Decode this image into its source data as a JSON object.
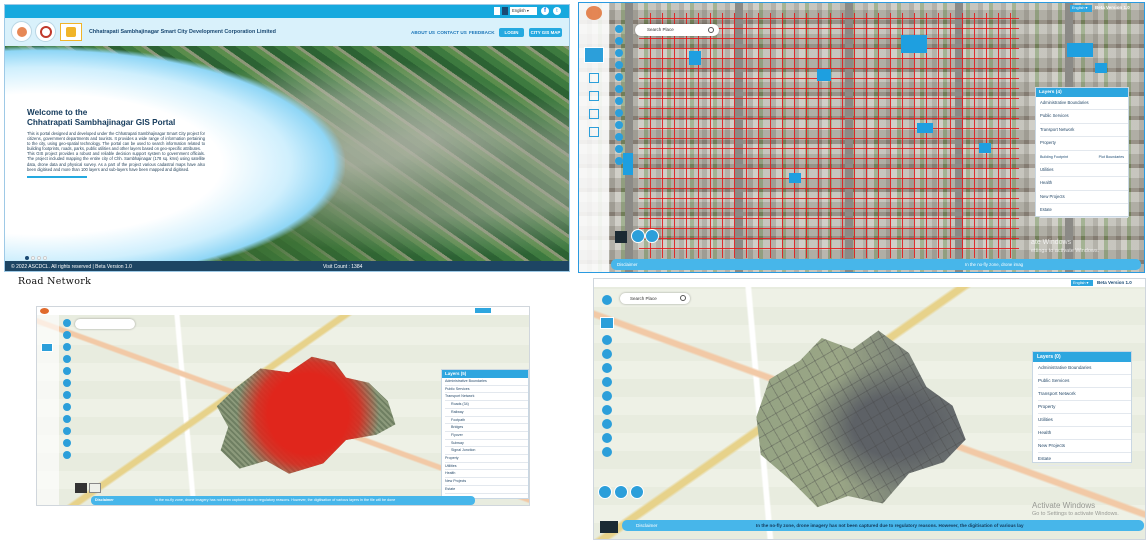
{
  "panel1": {
    "lang_select": "English",
    "org_name": "Chhatrapati Sambhajinagar Smart City Development Corporation Limited",
    "nav": [
      "ABOUT US",
      "CONTACT US",
      "FEEDBACK"
    ],
    "login_button": "LOGIN",
    "city_map_button": "CITY GIS MAP",
    "welcome_line1": "Welcome to the",
    "welcome_line2": "Chhatrapati Sambhajinagar GIS Portal",
    "para1": "This is portal designed and developed under the Chhatrapati Sambhajinagar Smart City project for citizens, government departments and tourists. It provides a wide range of information pertaining to the city, using geo-spatial technology. The portal can be used to search information related to building footprints, roads, parks, public utilities and other layers based on geo-specific attributes.",
    "para2": "This GIS project provides a robust and reliable decision support system to government officials. The project included mapping the entire city of Chh. Sambhajinagar (178 sq. kms) using satellite data, drone data and physical survey. As a part of the project various cadastral maps have also been digitised and more than 100 layers and sub-layers have been mapped and digitised.",
    "copyright": "© 2022 ASCDCL. All rights reserved | Beta Version 1.0",
    "visit_count": "Visit Count : 1384"
  },
  "panel2": {
    "caption": "Road Network",
    "layers_title": "Layers (5)",
    "layers": [
      "Administrative Boundaries",
      "Public Services",
      "Transport Network",
      "Roads (34)",
      "Railway",
      "Footpath",
      "Bridges",
      "Flyover",
      "Subway",
      "Signal Junction",
      "Property",
      "Utilities",
      "Health",
      "New Projects",
      "Estate"
    ],
    "disclaimer_label": "Disclaimer",
    "disclaimer_text": "In the no-fly zone, drone imagery has not been captured due to regulatory reasons. However, the digitisation of various layers in the file will be done"
  },
  "panel3": {
    "lang_select": "English",
    "version": "Beta Version 1.0",
    "search_placeholder": "Search Place",
    "layers_title": "Layers (4)",
    "layers": [
      "Administrative Boundaries",
      "Public Services",
      "Transport Network",
      "Property",
      "Utilities",
      "Health",
      "New Projects",
      "Estate"
    ],
    "property_sub": [
      "Building Footprint",
      "Plot Boundaries"
    ],
    "disclaimer_label": "Disclaimer",
    "disclaimer_text": "In the no-fly zone, drone imag",
    "watermark1": "ate Windows",
    "watermark2": "ettings to activate Windows."
  },
  "panel4": {
    "lang_select": "English",
    "version": "Beta Version 1.0",
    "search_placeholder": "Search Place",
    "layers_title": "Layers (0)",
    "layers": [
      "Administrative Boundaries",
      "Public Services",
      "Transport Network",
      "Property",
      "Utilities",
      "Health",
      "New Projects",
      "Estate"
    ],
    "disclaimer_label": "Disclaimer",
    "disclaimer_text": "In the no-fly zone, drone imagery has not been captured due to regulatory reasons. However, the digitisation of various lay",
    "watermark1": "Activate Windows",
    "watermark2": "Go to Settings to activate Windows."
  }
}
